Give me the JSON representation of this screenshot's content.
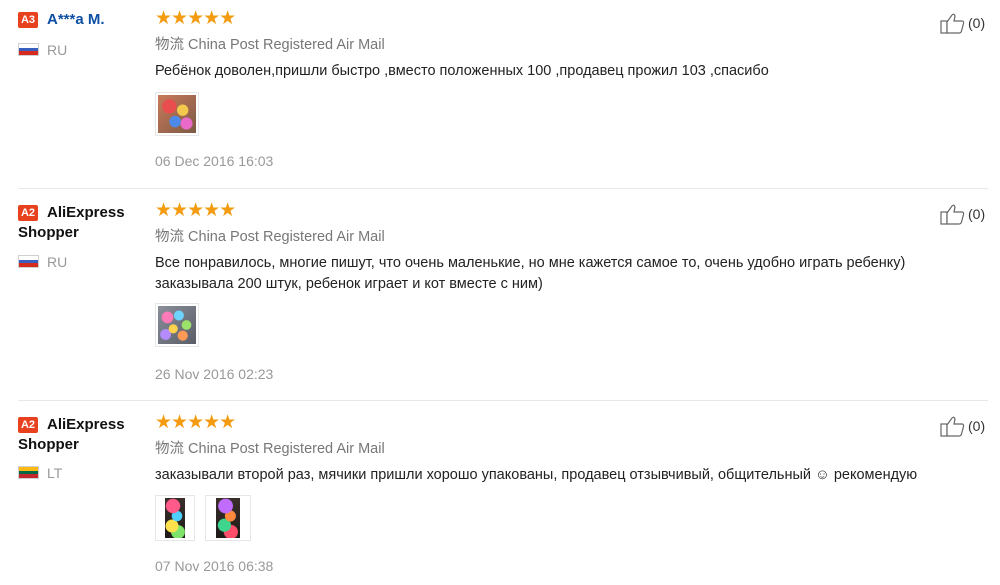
{
  "reviews": [
    {
      "level_badge": "A3",
      "user_name": "A***a M.",
      "country": "RU",
      "stars": "★★★★★",
      "logistics_label": "物流",
      "logistics_value": "China Post Registered Air Mail",
      "feedback": "Ребёнок доволен,пришли быстро ,вместо положенных 100 ,продавец прожил 103 ,спасибо",
      "date": "06 Dec 2016 16:03",
      "helpful_count": "(0)",
      "flag_colors": [
        "#ffffff",
        "#3b5fbf",
        "#d52b1e"
      ]
    },
    {
      "level_badge": "A2",
      "user_name": "AliExpress Shopper",
      "country": "RU",
      "stars": "★★★★★",
      "logistics_label": "物流",
      "logistics_value": "China Post Registered Air Mail",
      "feedback": "Все понравилось, многие пишут, что очень маленькие, но мне кажется самое то, очень удобно играть ребенку) заказывала 200 штук, ребенок играет и кот вместе с ним)",
      "date": "26 Nov 2016 02:23",
      "helpful_count": "(0)",
      "flag_colors": [
        "#ffffff",
        "#3b5fbf",
        "#d52b1e"
      ]
    },
    {
      "level_badge": "A2",
      "user_name": "AliExpress Shopper",
      "country": "LT",
      "stars": "★★★★★",
      "logistics_label": "物流",
      "logistics_value": "China Post Registered Air Mail",
      "feedback": "заказывали второй раз, мячики пришли хорошо упакованы, продавец отзывчивый, общительный ☺ рекомендую",
      "date": "07 Nov 2016 06:38",
      "helpful_count": "(0)",
      "flag_colors": [
        "#fdb913",
        "#006a44",
        "#c1272d"
      ]
    }
  ],
  "colors": {
    "badge": "#e8411e",
    "star": "#f39c12",
    "link_name": "#0d4fa3",
    "muted": "#999999"
  },
  "icons": {
    "star": "star-icon",
    "helpful": "thumbs-up-icon"
  }
}
